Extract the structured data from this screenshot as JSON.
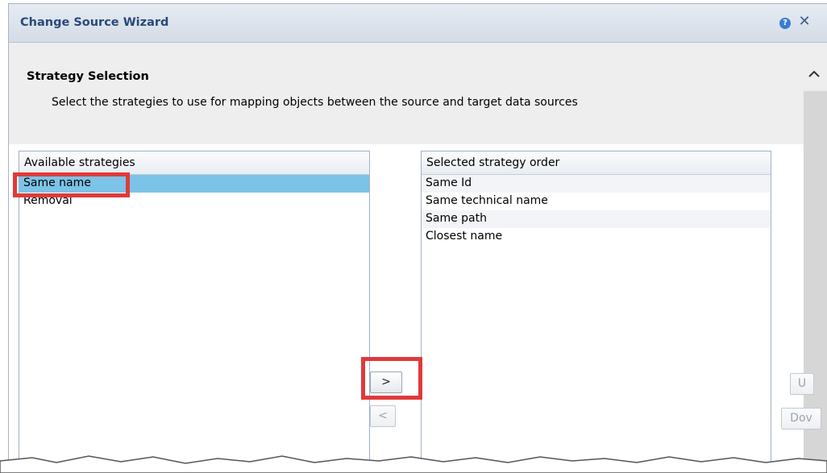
{
  "window": {
    "title": "Change Source Wizard",
    "help_icon": "?",
    "close_icon": "✕"
  },
  "section": {
    "title": "Strategy Selection",
    "description": "Select the strategies to use for mapping objects between the source and target data sources",
    "collapse_icon": "^"
  },
  "available": {
    "header": "Available strategies",
    "items": [
      {
        "label": "Same name",
        "selected": true
      },
      {
        "label": "Removal",
        "selected": false
      }
    ]
  },
  "selected": {
    "header": "Selected strategy order",
    "items": [
      {
        "label": "Same Id"
      },
      {
        "label": "Same technical name"
      },
      {
        "label": "Same path"
      },
      {
        "label": "Closest name"
      }
    ]
  },
  "buttons": {
    "add": ">",
    "remove": "<",
    "up": "U",
    "down": "Dov"
  },
  "colors": {
    "highlight": "#e03a3a",
    "selection": "#7cc3e8",
    "title_text": "#28497a"
  }
}
